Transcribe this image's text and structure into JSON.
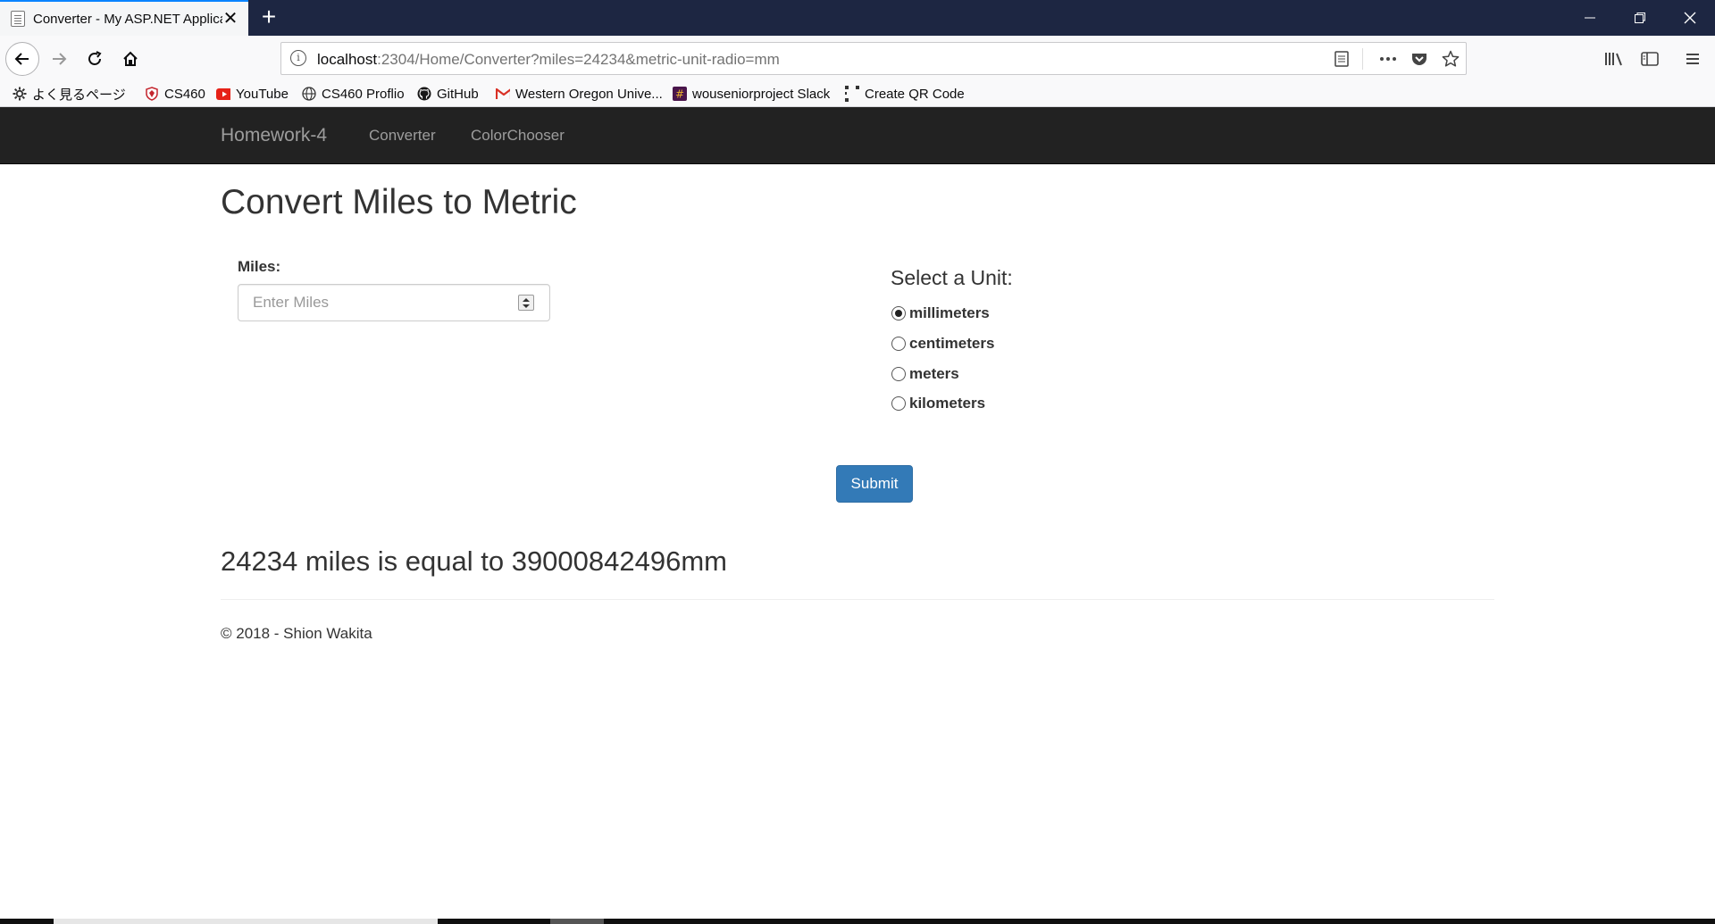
{
  "browser": {
    "tab_title": "Converter - My ASP.NET Application",
    "new_tab_symbol": "+",
    "close_symbol": "✕",
    "window": {
      "minimize": "—",
      "restore": "❐",
      "close": "✕"
    },
    "url_host": "localhost",
    "url_rest": ":2304/Home/Converter?miles=24234&metric-unit-radio=mm",
    "bookmarks": [
      {
        "label": "よく見るページ",
        "icon": "gear-icon"
      },
      {
        "label": "CS460",
        "icon": "shield-icon"
      },
      {
        "label": "YouTube",
        "icon": "youtube-icon"
      },
      {
        "label": "CS460 Proflio",
        "icon": "globe-icon"
      },
      {
        "label": "GitHub",
        "icon": "github-icon"
      },
      {
        "label": "Western Oregon Unive...",
        "icon": "gmail-icon"
      },
      {
        "label": "wouseniorproject Slack",
        "icon": "slack-icon"
      },
      {
        "label": "Create QR Code",
        "icon": "qr-icon"
      }
    ]
  },
  "site": {
    "brand": "Homework-4",
    "nav": [
      "Converter",
      "ColorChooser"
    ]
  },
  "main": {
    "title": "Convert Miles to Metric",
    "miles_label": "Miles:",
    "miles_placeholder": "Enter Miles",
    "unit_heading": "Select a Unit:",
    "units": [
      {
        "label": "millimeters",
        "checked": true
      },
      {
        "label": "centimeters",
        "checked": false
      },
      {
        "label": "meters",
        "checked": false
      },
      {
        "label": "kilometers",
        "checked": false
      }
    ],
    "submit_label": "Submit",
    "result": "24234 miles is equal to 39000842496mm"
  },
  "footer": {
    "text": "© 2018 - Shion Wakita"
  },
  "colors": {
    "titlebar": "#1d2642",
    "navbar": "#222222",
    "primary_button": "#337ab7",
    "tab_accent": "#0a84ff"
  }
}
